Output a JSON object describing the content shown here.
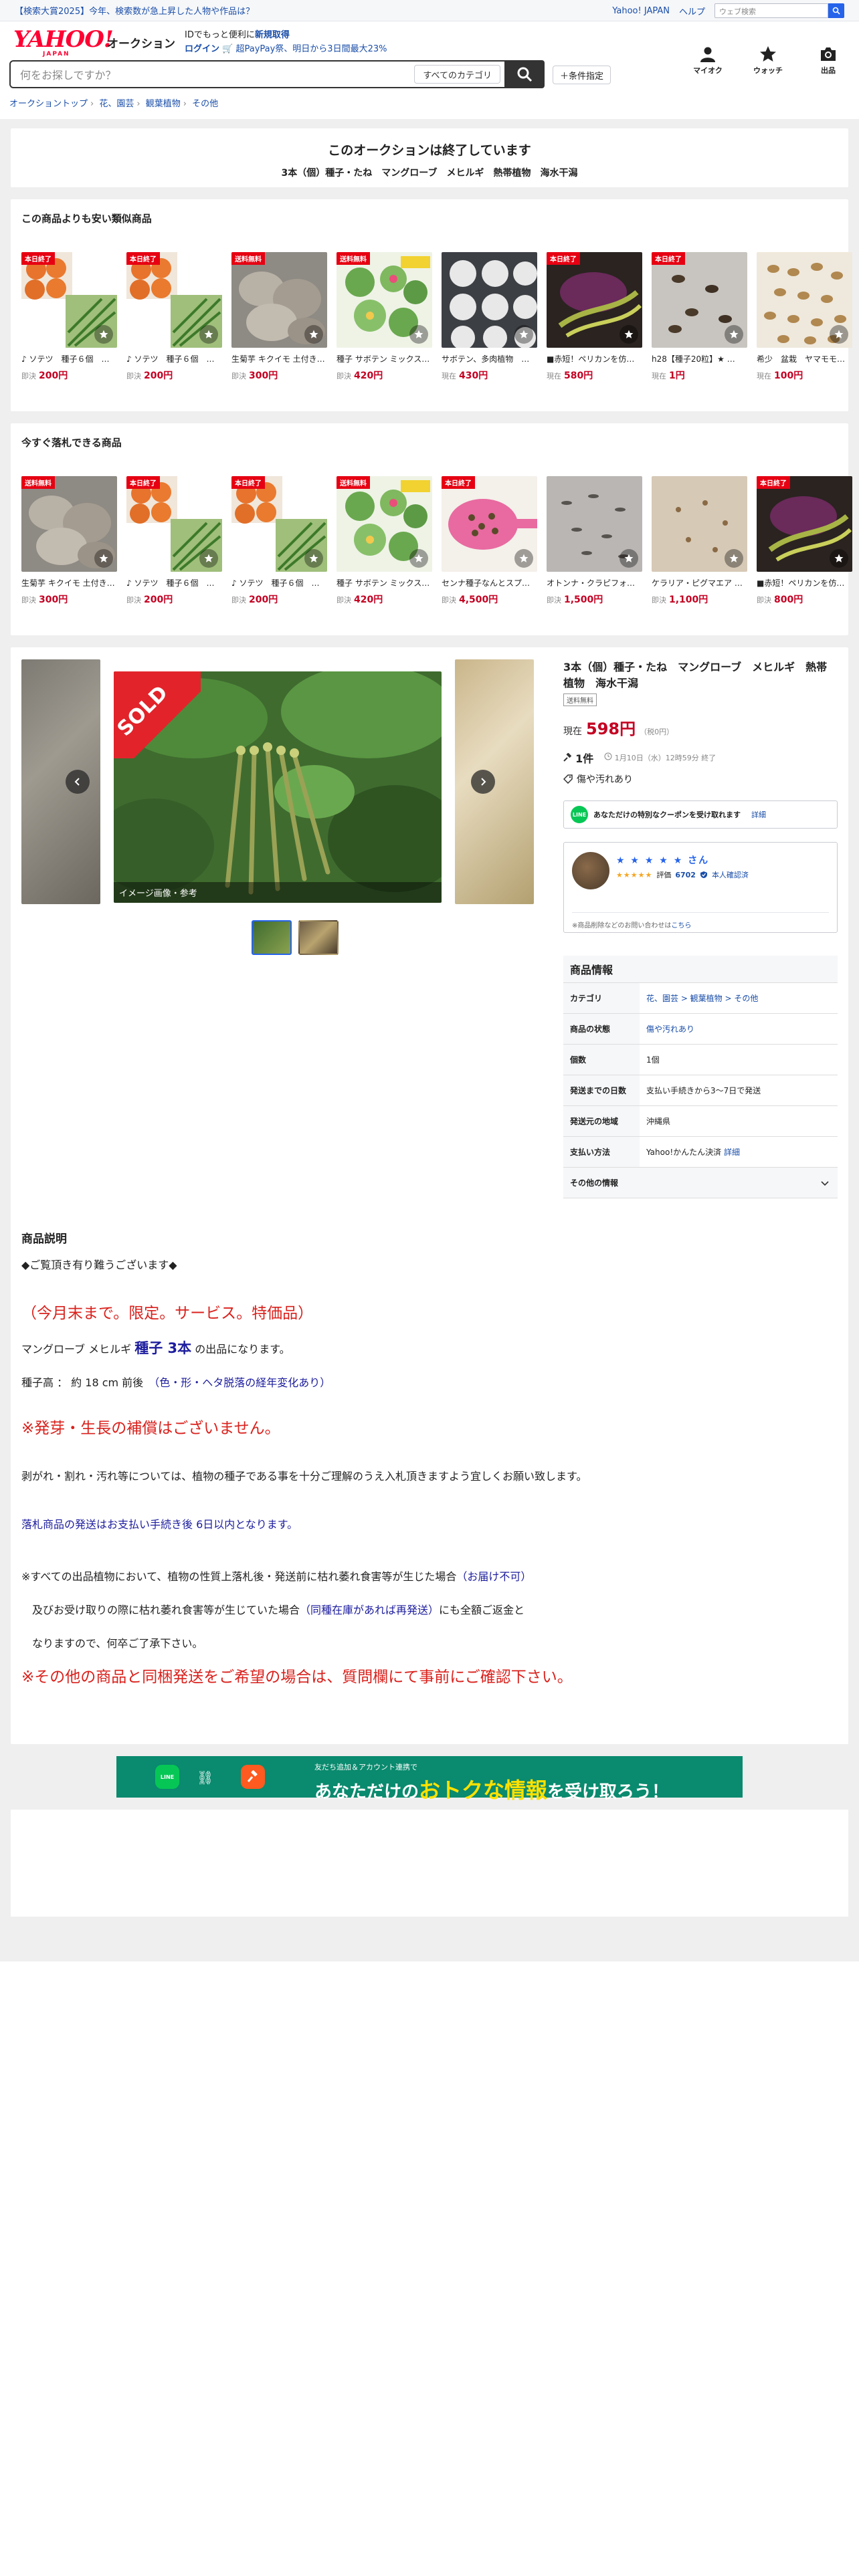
{
  "topbar": {
    "promo": "【検索大賞2025】今年、検索数が急上昇した人物や作品は？",
    "yahoo_japan": "Yahoo! JAPAN",
    "help": "ヘルプ",
    "web_search_placeholder": "ウェブ検索",
    "web_search_button": "検索"
  },
  "header": {
    "logo": "YAHOO!",
    "logo_sub": "JAPAN",
    "service": "オークション",
    "id_text": "IDでもっと便利に",
    "signup": "新規取得",
    "login": "ログイン",
    "paypay": "🛒 超PayPay祭、明日から3日間最大23%",
    "search_placeholder": "何をお探しですか？",
    "category_select": "すべてのカテゴリ",
    "advanced": "＋条件指定",
    "my_auction": "マイオク",
    "watch": "ウォッチ",
    "sell": "出品"
  },
  "breadcrumb": [
    "オークショントップ",
    "花、園芸",
    "観葉植物",
    "その他"
  ],
  "ended": {
    "heading": "このオークションは終了しています",
    "title": "3本（個）種子・たね　マングローブ　メヒルギ　熱帯植物　海水干潟"
  },
  "similar": {
    "heading": "この商品よりも安い類似商品",
    "items": [
      {
        "badge": "本日終了",
        "title": "♪ ソテツ　種子６個　…",
        "price_label": "即決",
        "price": "200円",
        "img": "sotetsu"
      },
      {
        "badge": "本日終了",
        "title": "♪ ソテツ　種子６個　…",
        "price_label": "即決",
        "price": "200円",
        "img": "sotetsu"
      },
      {
        "badge": "送料無料",
        "title": "生菊芋 キクイモ 土付き…",
        "price_label": "即決",
        "price": "300円",
        "img": "kikuimo"
      },
      {
        "badge": "送料無料",
        "title": "種子 サボテン ミックス…",
        "price_label": "即決",
        "price": "420円",
        "img": "cactus"
      },
      {
        "badge": "",
        "title": "サボテン、多肉植物　…",
        "price_label": "現在",
        "price": "430円",
        "img": "pots"
      },
      {
        "badge": "本日終了",
        "title": "■赤短！ペリカンを仿…",
        "price_label": "現在",
        "price": "580円",
        "img": "pelican"
      },
      {
        "badge": "本日終了",
        "title": "h28【種子20粒】★ …",
        "price_label": "現在",
        "price": "1円",
        "img": "seeds"
      },
      {
        "badge": "",
        "title": "希少　盆栽　ヤマモモ…",
        "price_label": "現在",
        "price": "100円",
        "img": "beans"
      }
    ]
  },
  "ending_soon": {
    "heading": "今すぐ落札できる商品",
    "items": [
      {
        "badge": "送料無料",
        "title": "生菊芋 キクイモ 土付き…",
        "price_label": "即決",
        "price": "300円",
        "img": "kikuimo"
      },
      {
        "badge": "本日終了",
        "title": "♪ ソテツ　種子６個　…",
        "price_label": "即決",
        "price": "200円",
        "img": "sotetsu"
      },
      {
        "badge": "本日終了",
        "title": "♪ ソテツ　種子６個　…",
        "price_label": "即決",
        "price": "200円",
        "img": "sotetsu"
      },
      {
        "badge": "送料無料",
        "title": "種子 サボテン ミックス…",
        "price_label": "即決",
        "price": "420円",
        "img": "cactus"
      },
      {
        "badge": "本日終了",
        "title": "センナ種子なんとスプ…",
        "price_label": "即決",
        "price": "4,500円",
        "img": "spoon"
      },
      {
        "badge": "",
        "title": "オトンナ・クラピフォ…",
        "price_label": "即決",
        "price": "1,500円",
        "img": "rice"
      },
      {
        "badge": "",
        "title": "ケラリア・ピグマエア …",
        "price_label": "即決",
        "price": "1,100円",
        "img": "seeds2"
      },
      {
        "badge": "本日終了",
        "title": "■赤短！ペリカンを仿…",
        "price_label": "即決",
        "price": "800円",
        "img": "pelican"
      }
    ]
  },
  "item": {
    "title": "3本（個）種子・たね　マングローブ　メヒルギ　熱帯植物　海水干潟",
    "shipping_tag": "送料無料",
    "price_label": "現在",
    "price": "598円",
    "tax": "（税0円）",
    "bids": "1件",
    "end": "1月10日（水）12時59分 終了",
    "condition": "傷や汚れあり",
    "sold_label": "SOLD",
    "image_caption": "イメージ画像・参考",
    "coupon_text": "あなただけの特別なクーポンを受け取れます",
    "coupon_link": "詳細",
    "seller_name": "★ ★ ★ ★ ★ さん",
    "seller_stars": "★★★★★",
    "seller_rating_label": "評価",
    "seller_rating": "6702",
    "seller_verified": "本人確認済",
    "seller_note_prefix": "※商品削除などのお問い合わせは",
    "seller_note_link": "こちら"
  },
  "spec": {
    "heading": "商品情報",
    "rows": [
      {
        "k": "カテゴリ",
        "v": "花、園芸 > 観葉植物 > その他"
      },
      {
        "k": "商品の状態",
        "v": "傷や汚れあり"
      },
      {
        "k": "個数",
        "v": "1個"
      },
      {
        "k": "発送までの日数",
        "v": "支払い手続きから3〜7日で発送"
      },
      {
        "k": "発送元の地域",
        "v": "沖縄県"
      },
      {
        "k": "支払い方法",
        "v": "Yahoo!かんたん決済",
        "link": "詳細"
      }
    ],
    "more": "その他の情報"
  },
  "description": {
    "heading": "商品説明",
    "l1": "◆ご覧頂き有り難うございます◆",
    "l2": "（今月末まで。限定。サービス。特価品）",
    "l3a": "マングローブ メヒルギ ",
    "l3b": "種子 3本",
    "l3c": " の出品になります。",
    "l4a": "種子高 ： 約 18 cm 前後　",
    "l4b": "（色・形・ヘタ脱落の経年変化あり）",
    "l5": "※発芽・生長の補償はございません。",
    "l6": "剥がれ・割れ・汚れ等については、植物の種子である事を十分ご理解のうえ入札頂きますよう宜しくお願い致します。",
    "l7": "落札商品の発送はお支払い手続き後 6日以内となります。",
    "l8a": "※すべての出品植物において、植物の性質上落札後・発送前に枯れ萎れ食害等が生じた場合",
    "l8b": "（お届け不可）",
    "l9a": "　及びお受け取りの際に枯れ萎れ食害等が生じていた場合",
    "l9b": "（同種在庫があれば再発送）",
    "l9c": "にも全額ご返金と",
    "l10": "　なりますので、何卒ご了承下さい。",
    "l11": "※その他の商品と同梱発送をご希望の場合は、質問欄にて事前にご確認下さい。"
  },
  "banner": {
    "line_label": "LINE",
    "small": "友だち追加＆アカウント連携で",
    "big1": "あなただけの",
    "big2": "おトクな情報",
    "big3": "を受け取ろう！"
  }
}
